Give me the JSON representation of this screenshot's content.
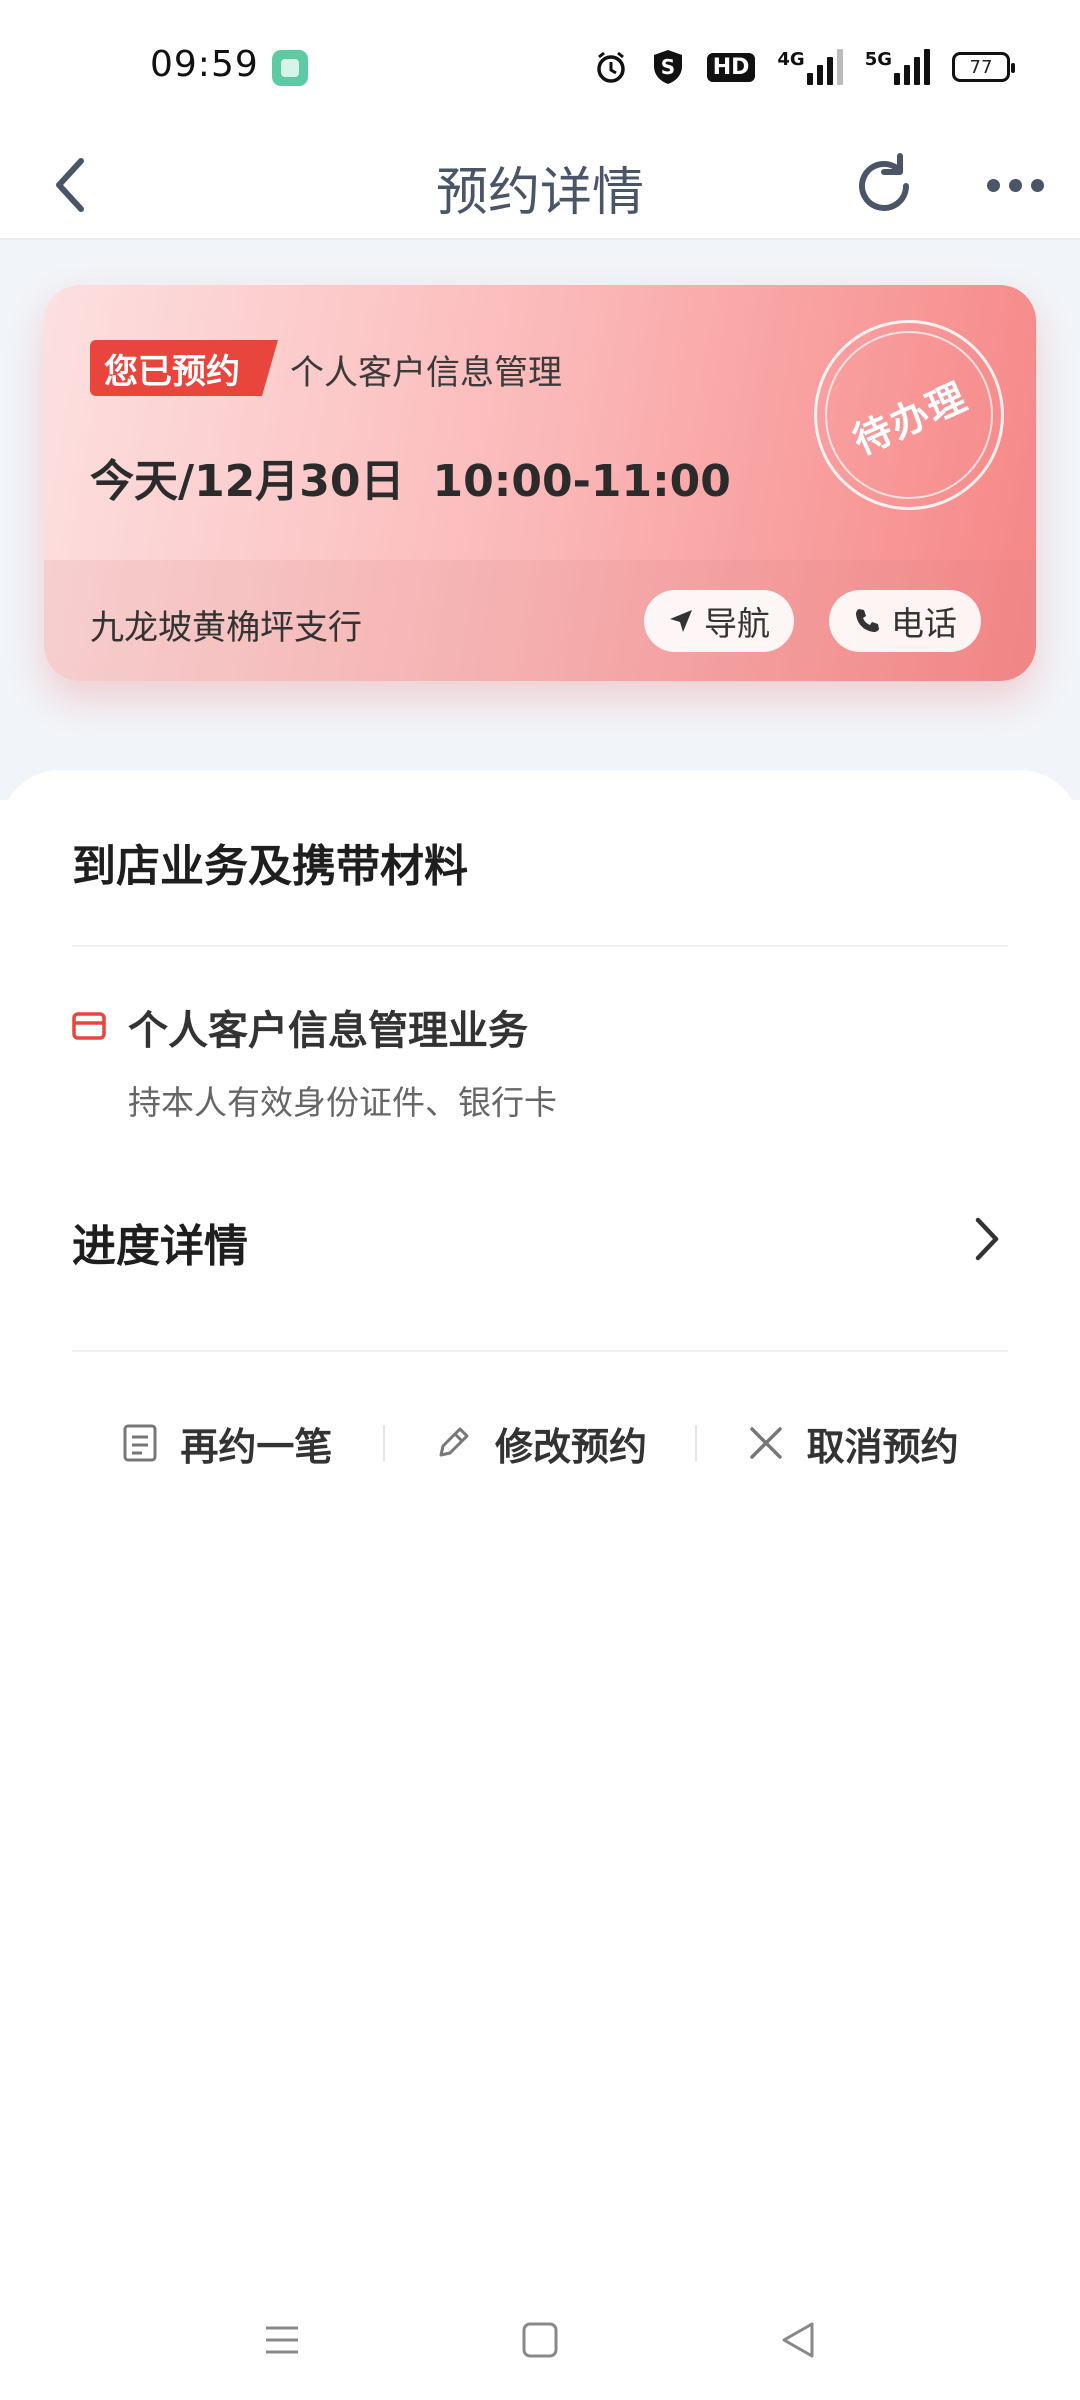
{
  "status_bar": {
    "time": "09:59",
    "app_icon": "green-app-icon",
    "icons": [
      "alarm-icon",
      "s-shield-icon",
      "hd-icon",
      "4g-signal-icon",
      "5g-signal-icon"
    ],
    "hd_label": "HD",
    "net_4g": "4G",
    "net_5g": "5G",
    "battery_level": "77"
  },
  "header": {
    "title": "预约详情",
    "back_icon": "chevron-left-icon",
    "refresh_icon": "refresh-icon",
    "more_icon": "more-dots-icon"
  },
  "appointment_card": {
    "badge": "您已预约",
    "service": "个人客户信息管理",
    "date": "今天/12月30日",
    "time": "10:00-11:00",
    "status_stamp": "待办理",
    "branch": "九龙坡黄桷坪支行",
    "navigate_label": "导航",
    "call_label": "电话",
    "colors": {
      "badge": "#e8453c",
      "card_gradient_end": "#f68686"
    }
  },
  "materials": {
    "title": "到店业务及携带材料",
    "item_name": "个人客户信息管理业务",
    "item_materials": "持本人有效身份证件、银行卡"
  },
  "progress": {
    "title": "进度详情"
  },
  "actions": {
    "rebook_label": "再约一笔",
    "modify_label": "修改预约",
    "cancel_label": "取消预约"
  }
}
